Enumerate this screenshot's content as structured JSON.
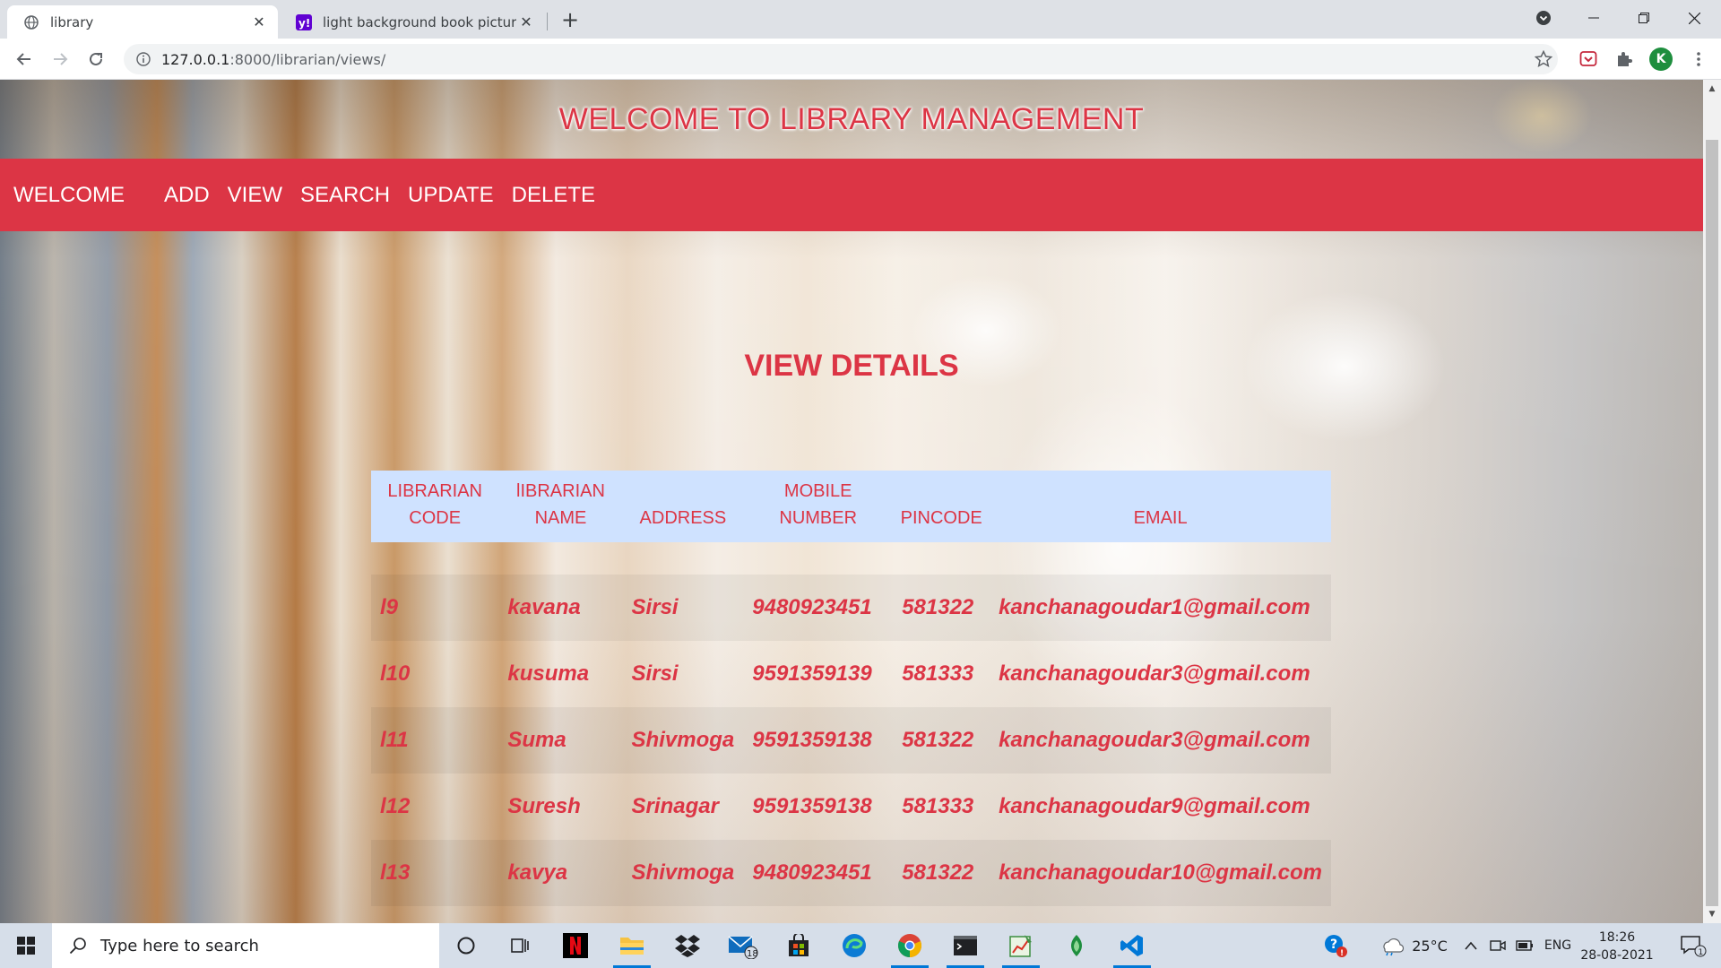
{
  "browser": {
    "tabs": [
      {
        "title": "library",
        "favicon": "globe-icon",
        "active": true
      },
      {
        "title": "light background book pictures -",
        "favicon": "yahoo-icon",
        "active": false
      }
    ],
    "new_tab": "+",
    "url_host": "127.0.0.1",
    "url_path": ":8000/librarian/views/",
    "profile_initial": "K"
  },
  "page": {
    "header_title": "WELCOME TO LIBRARY MANAGEMENT",
    "nav": {
      "brand": "WELCOME",
      "links": [
        "ADD",
        "VIEW",
        "SEARCH",
        "UPDATE",
        "DELETE"
      ]
    },
    "section_title": "VIEW DETAILS",
    "table": {
      "headers": [
        [
          "LIBRARIAN",
          "CODE"
        ],
        [
          "lIBRARIAN",
          "NAME"
        ],
        [
          "",
          "ADDRESS"
        ],
        [
          "MOBILE",
          "NUMBER"
        ],
        [
          "",
          "PINCODE"
        ],
        [
          "",
          "EMAIL"
        ]
      ],
      "rows": [
        [
          "l9",
          "kavana",
          "Sirsi",
          "9480923451",
          "581322",
          "kanchanagoudar1@gmail.com"
        ],
        [
          "l10",
          "kusuma",
          "Sirsi",
          "9591359139",
          "581333",
          "kanchanagoudar3@gmail.com"
        ],
        [
          "l11",
          "Suma",
          "Shivmoga",
          "9591359138",
          "581322",
          "kanchanagoudar3@gmail.com"
        ],
        [
          "l12",
          "Suresh",
          "Srinagar",
          "9591359138",
          "581333",
          "kanchanagoudar9@gmail.com"
        ],
        [
          "l13",
          "kavya",
          "Shivmoga",
          "9480923451",
          "581322",
          "kanchanagoudar10@gmail.com"
        ]
      ]
    }
  },
  "taskbar": {
    "search_placeholder": "Type here to search",
    "mail_badge": "18",
    "weather": "25°C",
    "language": "ENG",
    "time": "18:26",
    "date": "28-08-2021",
    "notification_count": "1"
  },
  "colors": {
    "accent": "#dc3545",
    "table_header_bg": "#cfe2ff"
  }
}
